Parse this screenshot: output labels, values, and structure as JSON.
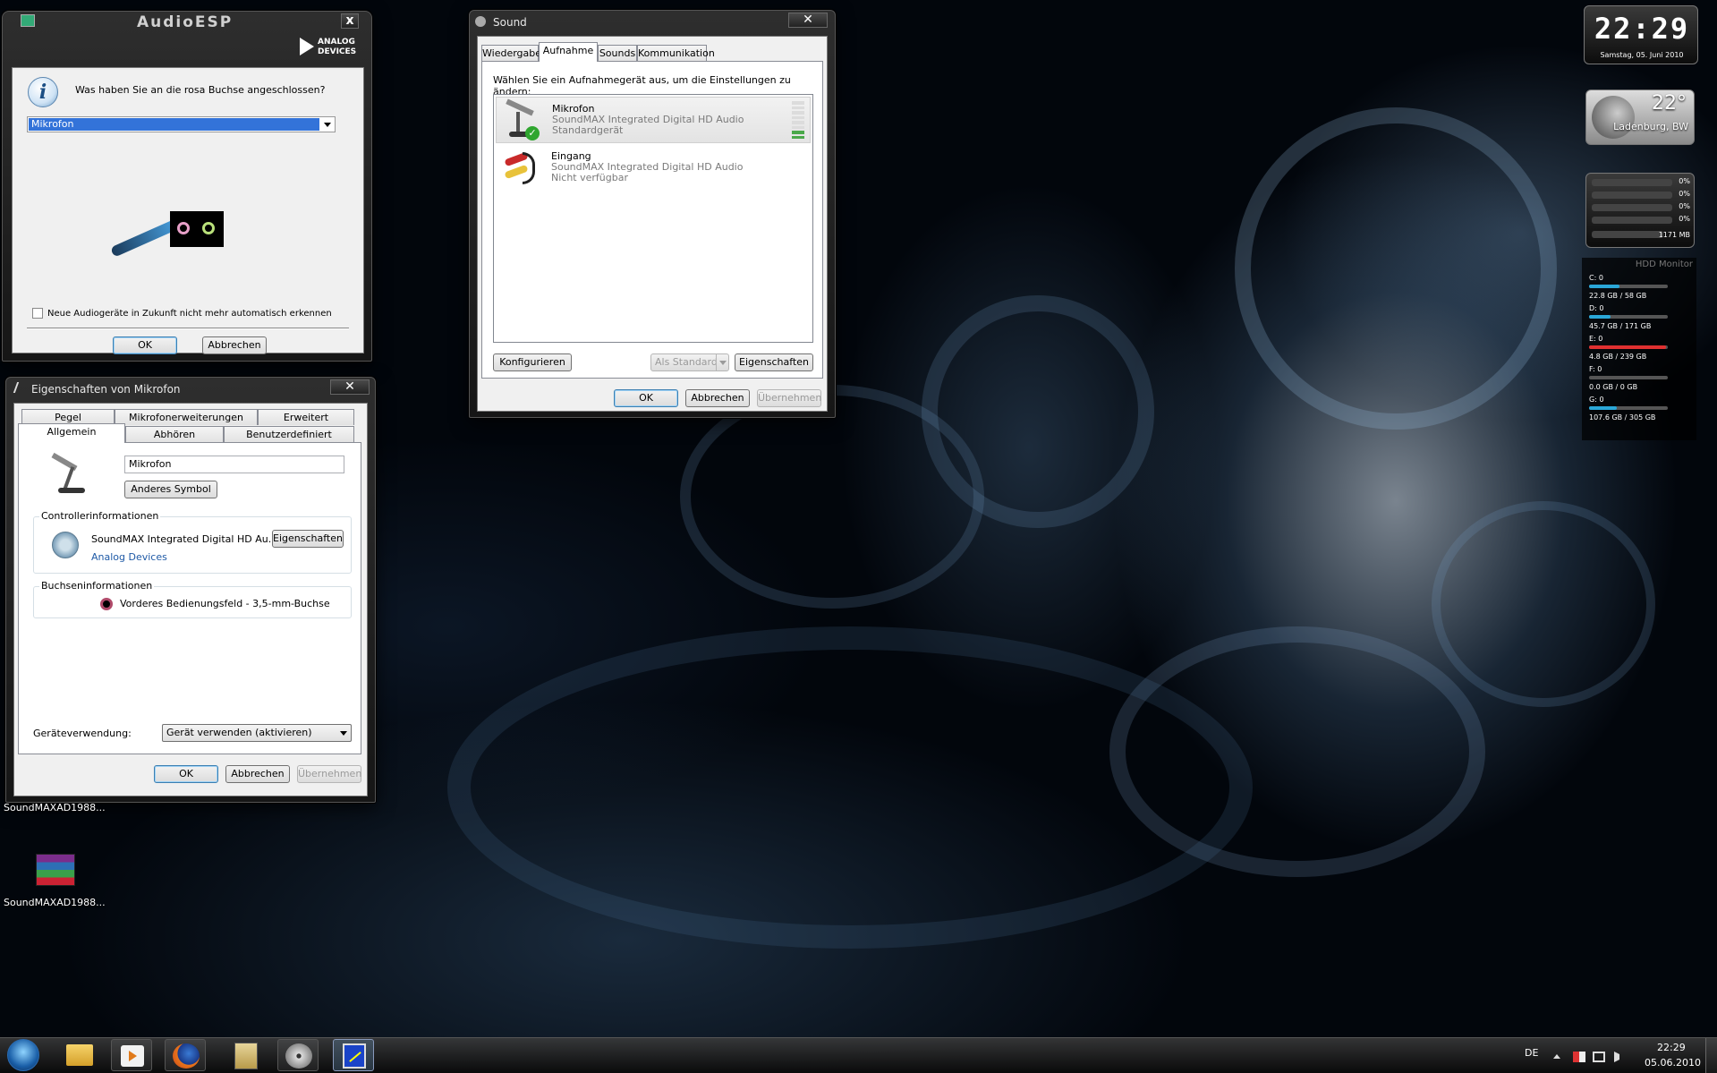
{
  "audioesp": {
    "title": "AudioESP",
    "logo_line1": "ANALOG",
    "logo_line2": "DEVICES",
    "close_glyph": "x",
    "question": "Was haben Sie an die rosa Buchse angeschlossen?",
    "selected_device": "Mikrofon",
    "checkbox_label": "Neue Audiogeräte in Zukunft nicht mehr automatisch erkennen",
    "checkbox_checked": false,
    "ok_label": "OK",
    "cancel_label": "Abbrechen"
  },
  "sound": {
    "title": "Sound",
    "close_glyph": "✕",
    "tabs": [
      "Wiedergabe",
      "Aufnahme",
      "Sounds",
      "Kommunikation"
    ],
    "active_tab": "Aufnahme",
    "instruction": "Wählen Sie ein Aufnahmegerät aus, um die Einstellungen zu ändern:",
    "devices": [
      {
        "name": "Mikrofon",
        "driver": "SoundMAX Integrated Digital HD Audio",
        "status": "Standardgerät",
        "icon": "microphone-icon",
        "level": 0.15
      },
      {
        "name": "Eingang",
        "driver": "SoundMAX Integrated Digital HD Audio",
        "status": "Nicht verfügbar",
        "icon": "rca-cable-icon"
      }
    ],
    "configure_label": "Konfigurieren",
    "set_default_label": "Als Standard",
    "properties_label": "Eigenschaften",
    "ok_label": "OK",
    "cancel_label": "Abbrechen",
    "apply_label": "Übernehmen"
  },
  "props": {
    "title": "Eigenschaften von Mikrofon",
    "close_glyph": "✕",
    "tabs_top": [
      "Pegel",
      "Mikrofonerweiterungen",
      "Erweitert"
    ],
    "tabs_bottom": [
      "Allgemein",
      "Abhören",
      "Benutzerdefiniert"
    ],
    "active_tab": "Allgemein",
    "device_name": "Mikrofon",
    "change_icon_label": "Anderes Symbol",
    "controller_header": "Controllerinformationen",
    "controller_name": "SoundMAX Integrated Digital HD Au...",
    "controller_props_label": "Eigenschaften",
    "controller_vendor": "Analog Devices",
    "jack_header": "Buchseninformationen",
    "jack_text": "Vorderes Bedienungsfeld - 3,5-mm-Buchse",
    "usage_label": "Geräteverwendung:",
    "usage_value": "Gerät verwenden (aktivieren)",
    "ok_label": "OK",
    "cancel_label": "Abbrechen",
    "apply_label": "Übernehmen"
  },
  "desktop": {
    "icons": [
      {
        "label": "SoundMAXAD1988..."
      },
      {
        "label": "SoundMAXAD1988..."
      }
    ]
  },
  "gadgets": {
    "clock_time": "22:29",
    "clock_date": "Samstag, 05. Juni 2010",
    "weather_temp": "22°",
    "weather_location": "Ladenburg, BW",
    "cpu_values": [
      "0%",
      "0%",
      "0%",
      "0%"
    ],
    "memory": "1171 MB",
    "hdd_title": "HDD Monitor",
    "drives": [
      {
        "label": "C: 0",
        "usage": "22.8 GB / 58 GB",
        "fill": 0.39,
        "color": "#2aa7d8"
      },
      {
        "label": "D: 0",
        "usage": "45.7 GB / 171 GB",
        "fill": 0.27,
        "color": "#2aa7d8"
      },
      {
        "label": "E: 0",
        "usage": "4.8 GB / 239 GB",
        "fill": 0.98,
        "color": "#e03030"
      },
      {
        "label": "F: 0",
        "usage": "0.0 GB / 0 GB",
        "fill": 0.0,
        "color": "#2aa7d8"
      },
      {
        "label": "G: 0",
        "usage": "107.6 GB / 305 GB",
        "fill": 0.35,
        "color": "#2aa7d8"
      }
    ]
  },
  "taskbar": {
    "language": "DE",
    "time": "22:29",
    "date": "05.06.2010",
    "pinned": [
      "explorer-icon",
      "media-player-icon",
      "firefox-icon",
      "archive-icon",
      "disc-icon",
      "audioesp-icon"
    ]
  }
}
